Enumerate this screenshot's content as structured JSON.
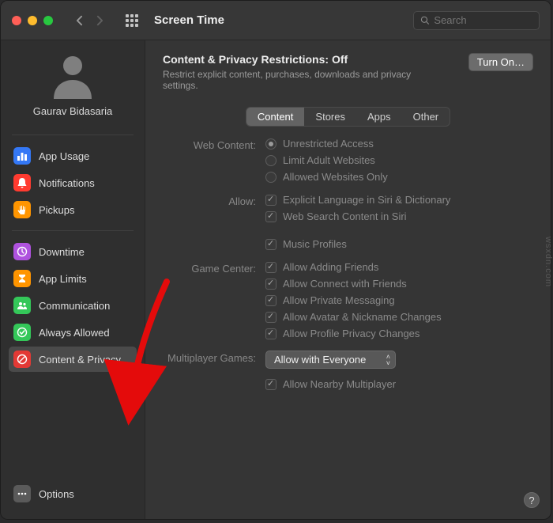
{
  "toolbar": {
    "title": "Screen Time",
    "search_placeholder": "Search"
  },
  "sidebar": {
    "username": "Gaurav Bidasaria",
    "group1": [
      {
        "label": "App Usage"
      },
      {
        "label": "Notifications"
      },
      {
        "label": "Pickups"
      }
    ],
    "group2": [
      {
        "label": "Downtime"
      },
      {
        "label": "App Limits"
      },
      {
        "label": "Communication"
      },
      {
        "label": "Always Allowed"
      },
      {
        "label": "Content & Privacy"
      }
    ],
    "options_label": "Options"
  },
  "main": {
    "heading_prefix": "Content & Privacy Restrictions: ",
    "heading_state": "Off",
    "subheading": "Restrict explicit content, purchases, downloads and privacy settings.",
    "turn_on_label": "Turn On…",
    "tabs": [
      "Content",
      "Stores",
      "Apps",
      "Other"
    ],
    "sections": {
      "web_content": {
        "label": "Web Content:",
        "options": [
          "Unrestricted Access",
          "Limit Adult Websites",
          "Allowed Websites Only"
        ],
        "selected": 0
      },
      "allow": {
        "label": "Allow:",
        "options": [
          "Explicit Language in Siri & Dictionary",
          "Web Search Content in Siri",
          "Music Profiles"
        ]
      },
      "game_center": {
        "label": "Game Center:",
        "options": [
          "Allow Adding Friends",
          "Allow Connect with Friends",
          "Allow Private Messaging",
          "Allow Avatar & Nickname Changes",
          "Allow Profile Privacy Changes"
        ]
      },
      "multiplayer": {
        "label": "Multiplayer Games:",
        "dropdown": "Allow with Everyone",
        "nearby": "Allow Nearby Multiplayer"
      }
    },
    "help": "?"
  },
  "watermark": "wsxdn.com"
}
